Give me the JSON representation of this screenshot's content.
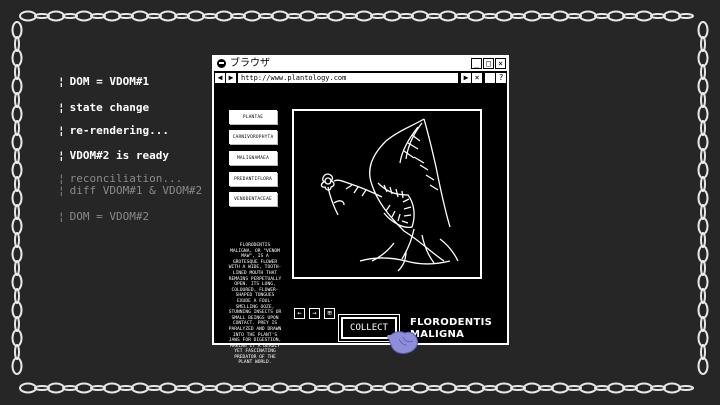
{
  "log": {
    "lines": [
      {
        "text": "DOM = VDOM#1",
        "state": "on"
      },
      {
        "text": "state change",
        "state": "on"
      },
      {
        "text": "re-rendering...",
        "state": "on"
      },
      {
        "text": "VDOM#2 is ready",
        "state": "on"
      },
      {
        "text": "reconciliation...",
        "state": "dim"
      },
      {
        "text": "diff VDOM#1 & VDOM#2",
        "state": "dim"
      },
      {
        "text": "DOM = VDOM#2",
        "state": "dim"
      }
    ]
  },
  "browser": {
    "title": "ブラウザ",
    "minimize_label": "_",
    "maximize_label": "□",
    "close_label": "×",
    "back_label": "◀",
    "forward_label": "▶",
    "url": "http://www.plantology.com",
    "go_label": "▶",
    "stop_label": "×",
    "help_label": "?"
  },
  "sidebar": {
    "items": [
      {
        "label": "PLANTAE"
      },
      {
        "label": "CARNIVOROPHYTA"
      },
      {
        "label": "MALIGNAMAEA"
      },
      {
        "label": "PREDANTIFLORA"
      },
      {
        "label": "VENODENTACEAE"
      }
    ]
  },
  "description": "Florodentis Maligna, or \"Venom Maw\", is a grotesque flower with a wide, tooth-lined mouth that remains perpetually open. Its long, coloured, flower-shaped tongues exude a foul-smelling ooze, stunning insects or small beings upon contact. Prey is paralyzed and drawn into the plant's jaws for digestion, making it a deadly yet fascinating predator of the plant world.",
  "controls": {
    "prev_label": "←",
    "next_label": "→",
    "grid_label": "⊞"
  },
  "collect_label": "COLLECT",
  "plant_name_line1": "FLORODENTIS",
  "plant_name_line2": "MALIGNA",
  "icons": {
    "cursor": "pointing-hand-icon",
    "title": "skull-icon"
  },
  "colors": {
    "background": "#262626",
    "frame": "#ffffff",
    "dim_text": "#8a8a8a",
    "hand": "#8d8dd9"
  }
}
